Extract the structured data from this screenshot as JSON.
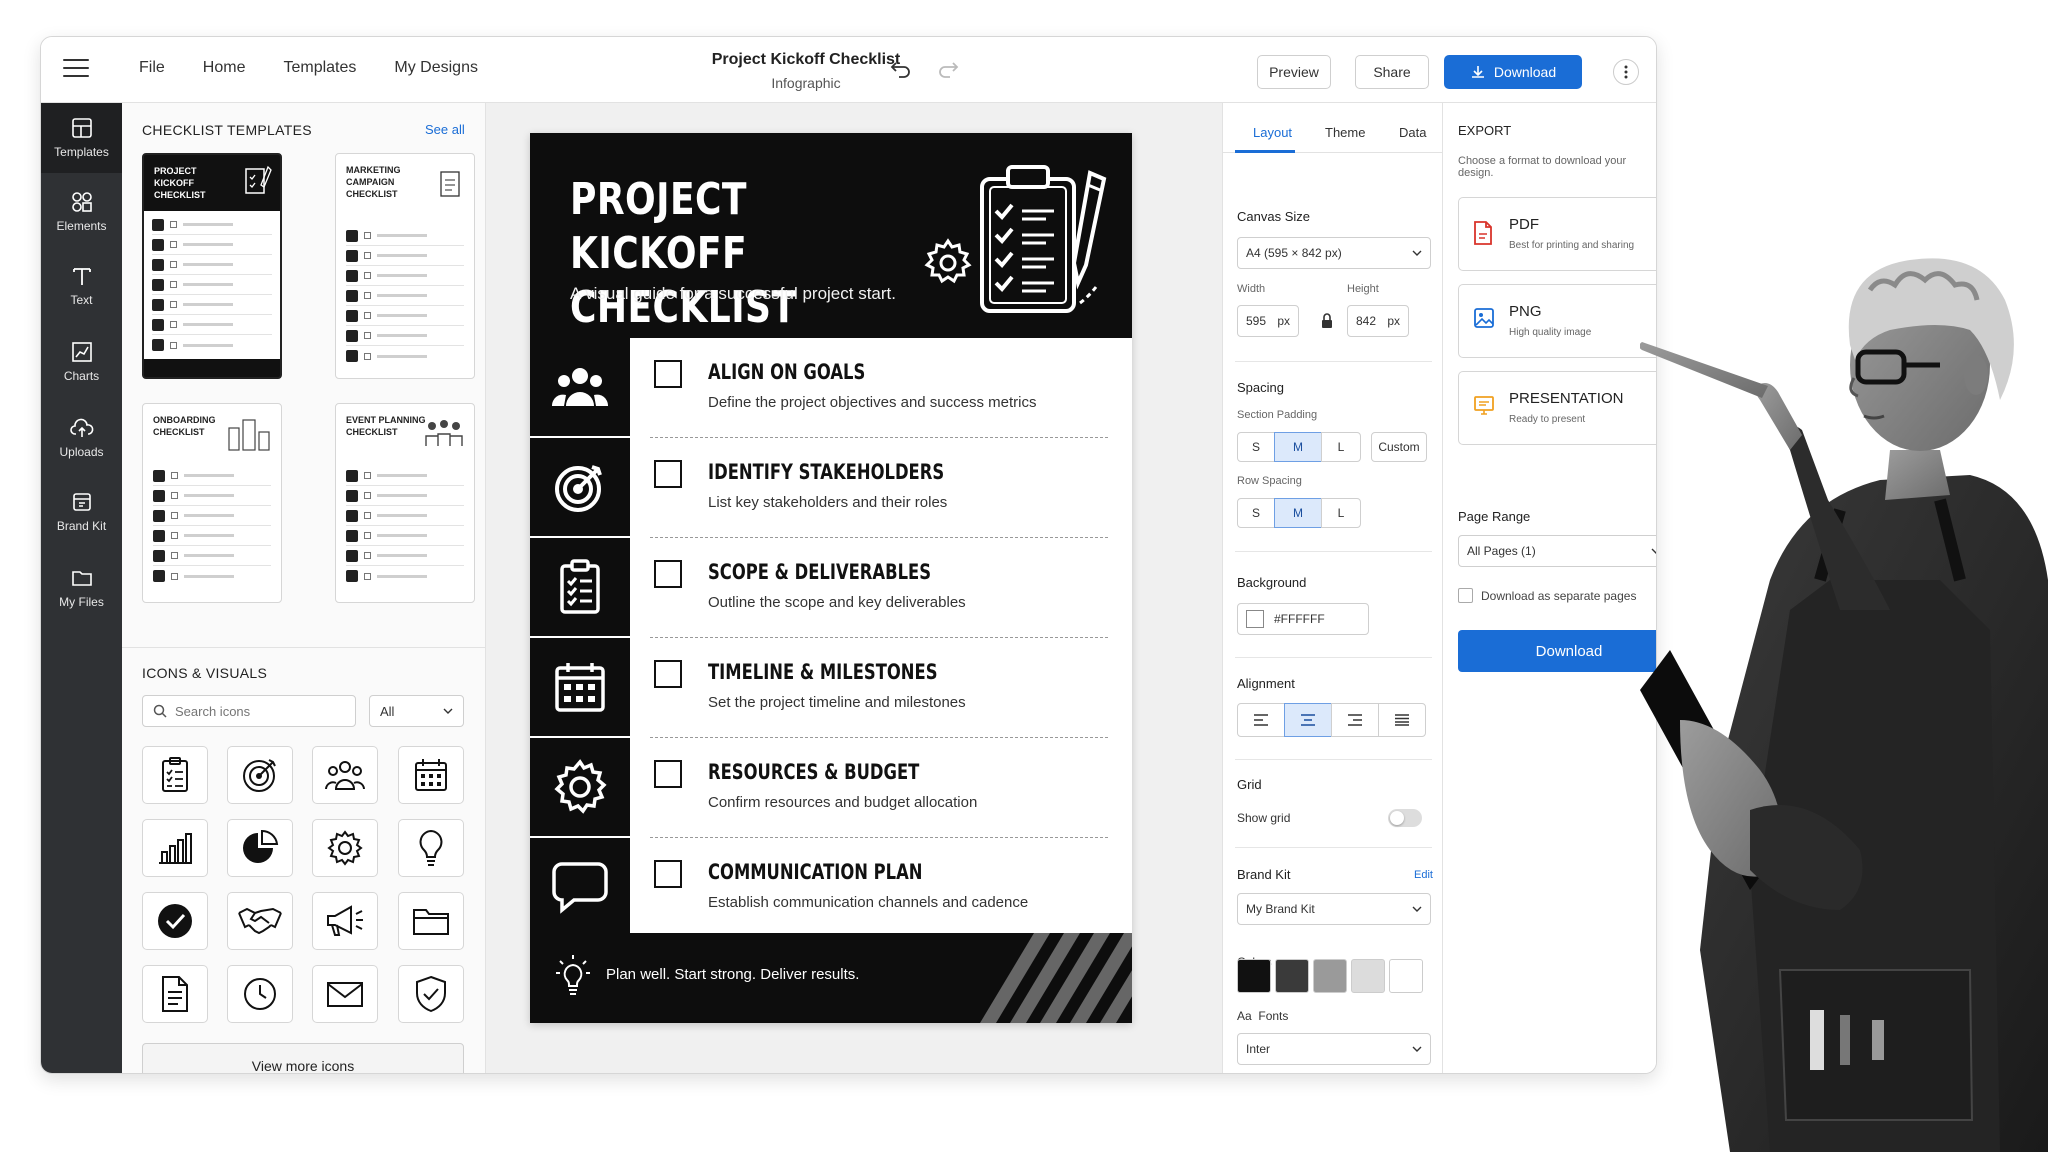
{
  "topbar": {
    "menu": [
      "File",
      "Home",
      "Templates",
      "My Designs"
    ],
    "doc_title": "Project Kickoff Checklist",
    "doc_subtitle": "Infographic",
    "preview_label": "Preview",
    "share_label": "Share",
    "download_label": "Download"
  },
  "rail": {
    "items": [
      "Templates",
      "Elements",
      "Text",
      "Charts",
      "Uploads",
      "Brand Kit",
      "My Files"
    ]
  },
  "left_panel": {
    "templates_title": "CHECKLIST TEMPLATES",
    "see_all": "See all",
    "templates": [
      {
        "title": "PROJECT KICKOFF CHECKLIST"
      },
      {
        "title": "MARKETING CAMPAIGN CHECKLIST"
      },
      {
        "title": "ONBOARDING CHECKLIST"
      },
      {
        "title": "EVENT PLANNING CHECKLIST"
      }
    ],
    "icons_title": "ICONS & VISUALS",
    "search_placeholder": "Search icons",
    "filter_value": "All",
    "icons": [
      "clipboard-icon",
      "target-icon",
      "team-icon",
      "calendar-icon",
      "bar-chart-icon",
      "pie-chart-icon",
      "gear-icon",
      "lightbulb-icon",
      "check-circle-icon",
      "handshake-icon",
      "megaphone-icon",
      "folder-icon",
      "document-icon",
      "clock-icon",
      "mail-icon",
      "shield-check-icon"
    ],
    "view_more": "View more icons"
  },
  "poster": {
    "title_line1": "PROJECT KICKOFF",
    "title_line2": "CHECKLIST",
    "subtitle": "A visual guide for a successful project start.",
    "items": [
      {
        "title": "ALIGN ON GOALS",
        "desc": "Define the project objectives and success metrics",
        "icon": "team-icon"
      },
      {
        "title": "IDENTIFY STAKEHOLDERS",
        "desc": "List key stakeholders and their roles",
        "icon": "target-icon"
      },
      {
        "title": "SCOPE & DELIVERABLES",
        "desc": "Outline the scope and key deliverables",
        "icon": "clipboard-icon"
      },
      {
        "title": "TIMELINE & MILESTONES",
        "desc": "Set the project timeline and milestones",
        "icon": "calendar-icon"
      },
      {
        "title": "RESOURCES & BUDGET",
        "desc": "Confirm resources and budget allocation",
        "icon": "gear-icon"
      },
      {
        "title": "COMMUNICATION PLAN",
        "desc": "Establish communication channels and cadence",
        "icon": "speech-bubble-icon"
      }
    ],
    "footer": "Plan well. Start strong. Deliver results."
  },
  "settings": {
    "tabs": [
      "Layout",
      "Theme",
      "Data"
    ],
    "canvas_size_label": "Canvas Size",
    "canvas_size_value": "A4 (595 × 842 px)",
    "width_label": "Width",
    "width_value": "595",
    "height_label": "Height",
    "height_value": "842",
    "unit": "px",
    "spacing_label": "Spacing",
    "section_padding_label": "Section Padding",
    "row_spacing_label": "Row Spacing",
    "sizes": [
      "S",
      "M",
      "L"
    ],
    "custom_label": "Custom",
    "background_label": "Background",
    "background_value": "#FFFFFF",
    "alignment_label": "Alignment",
    "grid_label": "Grid",
    "show_grid_label": "Show grid",
    "show_grid": false,
    "brand_kit_label": "Brand Kit",
    "edit_label": "Edit",
    "brand_kit_value": "My Brand Kit",
    "colors_label": "Colors",
    "colors": [
      "#111111",
      "#3a3a3a",
      "#9a9a9a",
      "#dcdcdc",
      "#ffffff"
    ],
    "fonts_prefix": "Aa",
    "fonts_label": "Fonts",
    "font_value": "Inter"
  },
  "export": {
    "title": "EXPORT",
    "subtitle": "Choose a format to download your design.",
    "formats": [
      {
        "name": "PDF",
        "desc": "Best for printing and sharing",
        "color": "#d9342b"
      },
      {
        "name": "PNG",
        "desc": "High quality image",
        "color": "#1a6dd6"
      },
      {
        "name": "PRESENTATION",
        "desc": "Ready to present",
        "color": "#f0a020"
      }
    ],
    "page_range_label": "Page Range",
    "page_range_value": "All Pages (1)",
    "separate_pages_label": "Download as separate pages",
    "download_label": "Download"
  },
  "accent_color": "#1a6dd6"
}
